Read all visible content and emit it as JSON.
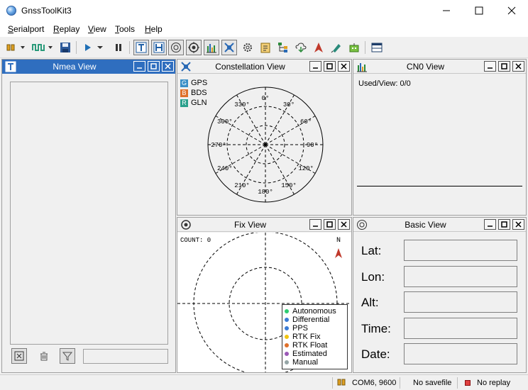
{
  "window": {
    "title": "GnssToolKit3"
  },
  "menu": {
    "items": [
      "Serialport",
      "Replay",
      "View",
      "Tools",
      "Help"
    ]
  },
  "panels": {
    "nmea": {
      "title": "Nmea View"
    },
    "constellation": {
      "title": "Constellation View",
      "legend": [
        {
          "code": "G",
          "label": "GPS",
          "color": "#3a8fc7"
        },
        {
          "code": "B",
          "label": "BDS",
          "color": "#e0702a"
        },
        {
          "code": "R",
          "label": "GLN",
          "color": "#2aa08c"
        }
      ],
      "angles": [
        "0°",
        "30°",
        "60°",
        "90°",
        "120°",
        "150°",
        "180°",
        "210°",
        "240°",
        "270°",
        "300°",
        "330°"
      ]
    },
    "cn0": {
      "title": "CN0 View",
      "used_view": "Used/View: 0/0"
    },
    "fix": {
      "title": "Fix View",
      "count": "COUNT: 0",
      "north": "N",
      "legend": [
        {
          "label": "Autonomous",
          "color": "#2ecc71"
        },
        {
          "label": "Differential",
          "color": "#3a7bd5"
        },
        {
          "label": "PPS",
          "color": "#3a7bd5"
        },
        {
          "label": "RTK Fix",
          "color": "#f1c40f"
        },
        {
          "label": "RTK Float",
          "color": "#e0702a"
        },
        {
          "label": "Estimated",
          "color": "#9b59b6"
        },
        {
          "label": "Manual",
          "color": "#95a5a6"
        }
      ]
    },
    "basic": {
      "title": "Basic View",
      "fields": [
        {
          "label": "Lat:",
          "value": ""
        },
        {
          "label": "Lon:",
          "value": ""
        },
        {
          "label": "Alt:",
          "value": ""
        },
        {
          "label": "Time:",
          "value": ""
        },
        {
          "label": "Date:",
          "value": ""
        }
      ]
    }
  },
  "status": {
    "port": "COM6, 9600",
    "savefile": "No savefile",
    "replay": "No replay"
  }
}
